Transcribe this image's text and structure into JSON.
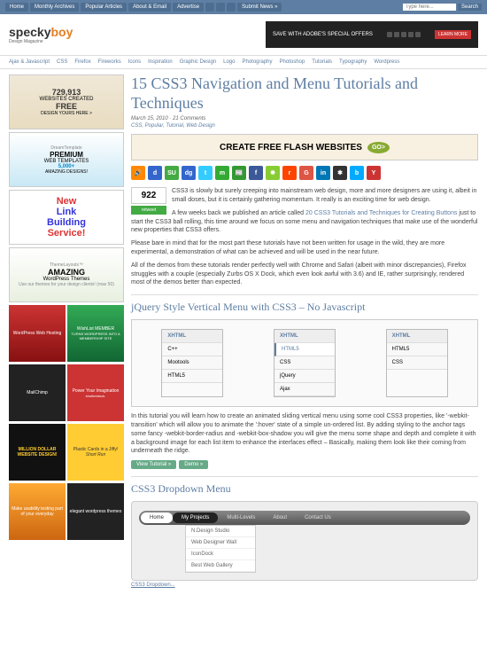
{
  "topbar": {
    "items": [
      "Home",
      "Monthly Archives",
      "Popular Articles",
      "About & Email",
      "Advertise"
    ],
    "submit": "Submit News »",
    "search_placeholder": "Type here...",
    "search_btn": "Search"
  },
  "logo": {
    "text1": "specky",
    "text2": "boy",
    "sub": "Design Magazine"
  },
  "banner": {
    "text": "SAVE WITH ADOBE'S SPECIAL OFFERS",
    "btn": "LEARN MORE"
  },
  "nav": [
    "Ajax & Javascript",
    "CSS",
    "Firefox",
    "Fireworks",
    "Icons",
    "Inspiration",
    "Graphic Design",
    "Logo",
    "Photography",
    "Photoshop",
    "Tutorials",
    "Typography",
    "Wordpress"
  ],
  "title": "15 CSS3 Navigation and Menu Tutorials and Techniques",
  "meta": "March 15, 2010 · 21 Comments",
  "cats": "CSS, Popular, Tutorial, Web Design",
  "flash": {
    "text": "CREATE FREE FLASH WEBSITES",
    "go": "GO>"
  },
  "retweet": {
    "count": "922",
    "btn": "retweet"
  },
  "para1": "CSS3 is slowly but surely creeping into mainstream web design, more and more designers are using it, albeit in small doses, but it is certainly gathering momentum. It really is an exciting time for web design.",
  "para2a": "A few weeks back we published an article called ",
  "para2link": "20 CSS3 Tutorials and Techniques for Creating Buttons",
  "para2b": " just to start the CSS3 ball rolling, this time around we focus on some menu and navigation techniques that make use of the wonderful new properties that CSS3 offers.",
  "para3": "Please bare in mind that for the most part these tutorials have not been written for usage in the wild, they are more experimental, a demonstration of what can be achieved and will be used in the near future.",
  "para4": "All of the demos from these tutorials render perfectly well with Chrome and Safari (albeit with minor discrepancies), Firefox struggles with a couple (especially Zurbs OS X Dock, which even look awful with 3.6) and IE, rather surprisingly, rendered most of the demos better than expected.",
  "h2_1": "jQuery Style Vertical Menu with CSS3 – No Javascript",
  "vmenu1": [
    "XHTML",
    "C++",
    "Mootools",
    "HTML5"
  ],
  "vmenu2": [
    "XHTML",
    "HTML5",
    "CSS",
    "jQuery",
    "Ajax"
  ],
  "vmenu3": [
    "XHTML",
    "HTML5",
    "CSS"
  ],
  "tut_p1": "In this tutorial you will learn how to create an animated sliding vertical menu using some cool CSS3 properties, like '-webkit-transition' which will allow you to animate the ':hover' state of a simple un-ordered list. By adding styling to the anchor tags some fancy -webkit-border-radius and -webkit-box-shadow you will give the menu some shape and depth and complete it with a background image for each list item to enhance the interfaces effect – Basically, making them look like their coming from underneath the ridge.",
  "tut_btns": [
    "View Tutorial »",
    "Demo »"
  ],
  "h2_2": "CSS3 Dropdown Menu",
  "dd": {
    "items": [
      "Home",
      "My Projects",
      "Multi-Levels",
      "About",
      "Contact Us"
    ],
    "sub": [
      "N.Design Studio",
      "Web Designer Wall",
      "IconDock",
      "Best Web Gallery"
    ],
    "caption": "CSS3 Dropdown..."
  },
  "ads": {
    "free": {
      "n": "729,913",
      "t1": "WEBSITES CREATED",
      "t2": "FREE",
      "t3": "DESIGN YOURS HERE >"
    },
    "premium": {
      "t0": "DreamTemplate",
      "t1": "PREMIUM",
      "t2": "WEB TEMPLATES",
      "t3": "5,000+",
      "t4": "AMAZING DESIGNS!"
    },
    "link": {
      "t1": "New",
      "t2": "Link",
      "t3": "Building",
      "t4": "Service!"
    },
    "amazing": {
      "t0": "ThemeLayouts™",
      "t1": "AMAZING",
      "t2": "WordPress Themes",
      "t3": "Use our themes for your design clients! (max 50)"
    },
    "wp": {
      "t": "WordPress Web Hosting"
    },
    "wish": {
      "t": "WishList MEMBER",
      "s": "TURNS WORDPRESS INTO A MEMBERSHIP SITE"
    },
    "mail": {
      "t": "MailChimp"
    },
    "shutter": {
      "t": "Power Your Imagination",
      "s": "shutterstock."
    },
    "million": {
      "t": "MILLION DOLLAR WEBSITE DESIGN!"
    },
    "plastic": {
      "t": "Plastic Cards in a Jiffy!",
      "s": "Short Run"
    },
    "usability": {
      "t": "Make usability testing part of your everyday"
    },
    "elegant": {
      "t": "elegant wordpress themes"
    }
  },
  "icons": [
    {
      "bg": "#f80",
      "t": "🔊"
    },
    {
      "bg": "#36c",
      "t": "d"
    },
    {
      "bg": "#4a4",
      "t": "SU"
    },
    {
      "bg": "#36c",
      "t": "dg"
    },
    {
      "bg": "#3cf",
      "t": "t"
    },
    {
      "bg": "#3a3",
      "t": "m"
    },
    {
      "bg": "#393",
      "t": "📰"
    },
    {
      "bg": "#3b5998",
      "t": "f"
    },
    {
      "bg": "#8c3",
      "t": "❋"
    },
    {
      "bg": "#f40",
      "t": "r"
    },
    {
      "bg": "#d54",
      "t": "G"
    },
    {
      "bg": "#0077b5",
      "t": "in"
    },
    {
      "bg": "#333",
      "t": "✱"
    },
    {
      "bg": "#0af",
      "t": "b"
    },
    {
      "bg": "#c33",
      "t": "Y"
    }
  ]
}
